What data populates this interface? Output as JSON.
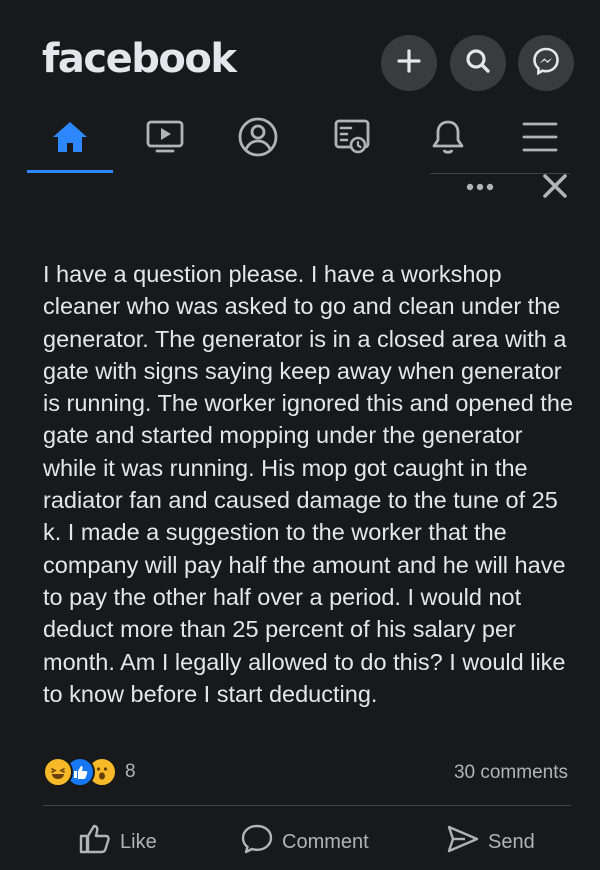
{
  "app": {
    "logo_text": "facebook"
  },
  "header": {
    "buttons": [
      {
        "icon": "plus-icon"
      },
      {
        "icon": "search-icon"
      },
      {
        "icon": "messenger-icon"
      }
    ]
  },
  "nav": {
    "items": [
      {
        "icon": "home-icon",
        "active": true
      },
      {
        "icon": "video-icon"
      },
      {
        "icon": "profile-icon"
      },
      {
        "icon": "marketplace-icon"
      },
      {
        "icon": "notifications-icon"
      },
      {
        "icon": "menu-icon"
      }
    ],
    "active_color": "#2d88ff"
  },
  "post": {
    "more_icon": "more-dots-icon",
    "close_icon": "close-icon",
    "text": "I have a question please. I have a workshop cleaner who was asked to go and clean under the generator. The generator is in a closed area with a gate with signs saying keep away when generator is running. The worker ignored this and opened the gate and started mopping under the generator while it was running. His mop got caught in the radiator fan and caused damage to the tune of 25 k. I made a suggestion to the worker that the company will pay half the amount and he will have to pay the other half over a period. I would not deduct more than 25 percent of his salary per month. Am I legally allowed to do this? I would like to know before I start deducting.",
    "reactions": [
      "haha-icon",
      "like-icon",
      "wow-icon"
    ],
    "reaction_count": "8",
    "comments_label": "30 comments"
  },
  "actions": {
    "like_label": "Like",
    "comment_label": "Comment",
    "send_label": "Send"
  },
  "colors": {
    "background": "#18191a",
    "text": "#e4e6eb",
    "secondary_text": "#b0b3b8",
    "button_bg": "#3a3b3c"
  }
}
